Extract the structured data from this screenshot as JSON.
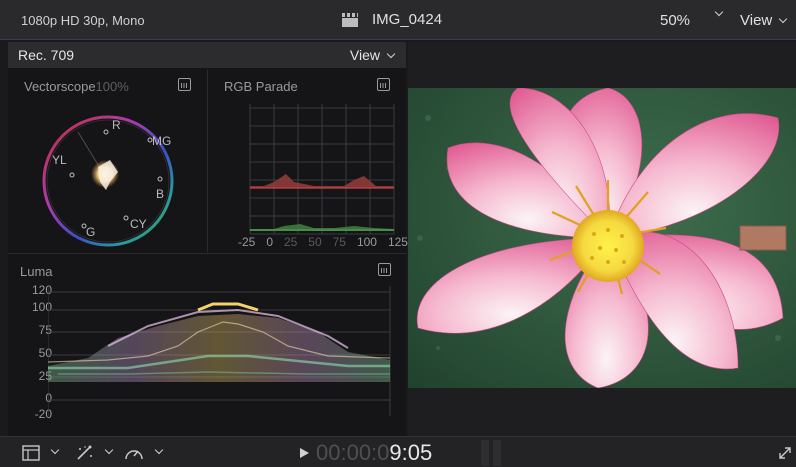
{
  "topbar": {
    "format": "1080p HD 30p, Mono",
    "clip_name": "IMG_0424",
    "zoom": "50%",
    "view": "View"
  },
  "scopes": {
    "colorspace": "Rec. 709",
    "view": "View",
    "vectorscope": {
      "title": "Vectorscope",
      "percent": "100%",
      "labels": {
        "r": "R",
        "mg": "MG",
        "b": "B",
        "cy": "CY",
        "g": "G",
        "yl": "YL"
      }
    },
    "rgb_parade": {
      "title": "RGB Parade",
      "x_ticks": [
        "-25",
        "0",
        "25",
        "50",
        "75",
        "100",
        "125"
      ]
    },
    "luma": {
      "title": "Luma",
      "y_ticks": [
        "120",
        "100",
        "75",
        "50",
        "25",
        "0",
        "-20"
      ]
    }
  },
  "playback": {
    "timecode_dim": "00:00:0",
    "timecode_lit": "9:05"
  },
  "icons": {
    "clip": "clapperboard-icon",
    "scope_settings": "waveform-settings-icon",
    "play": "play-icon",
    "layout": "layout-icon",
    "transform": "transform-wand-icon",
    "speed": "speed-gauge-icon",
    "fullscreen": "fullscreen-icon"
  }
}
